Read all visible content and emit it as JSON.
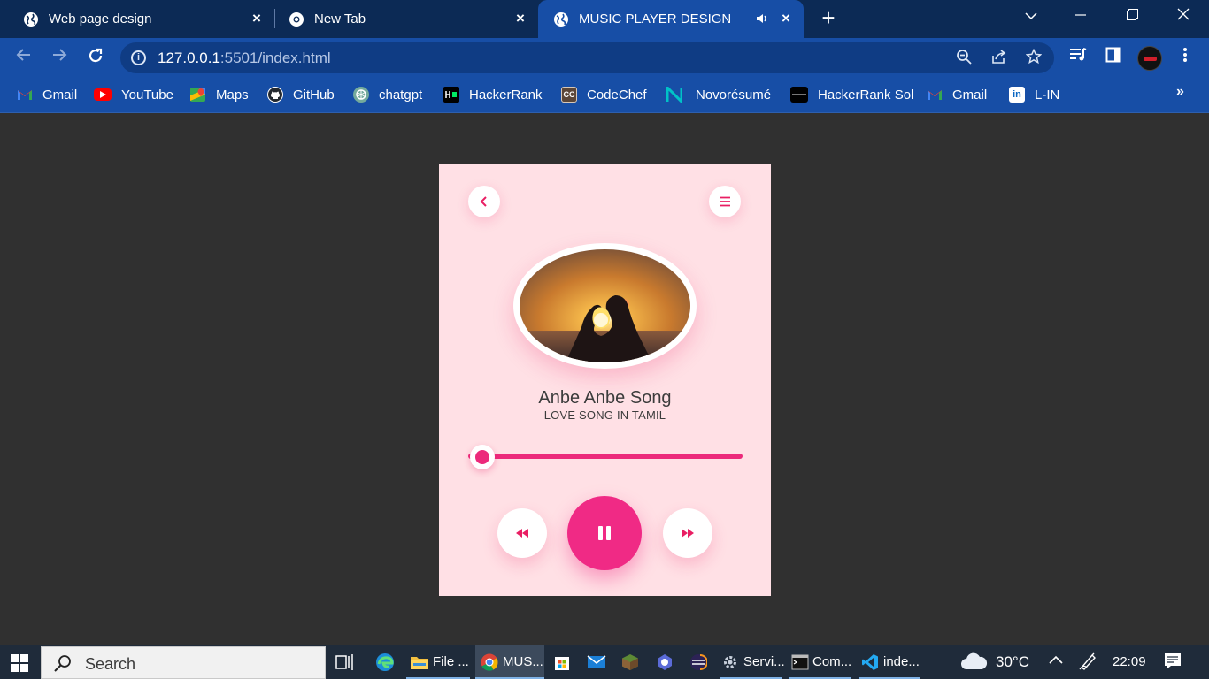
{
  "tabs": [
    {
      "title": "Web page design",
      "active": false,
      "icon": "globe-icon"
    },
    {
      "title": "New Tab",
      "active": false,
      "icon": "chrome-icon"
    },
    {
      "title": "MUSIC PLAYER DESIGN",
      "active": true,
      "icon": "globe-icon",
      "audio": true
    }
  ],
  "address": {
    "host": "127.0.0.1",
    "rest": ":5501/index.html"
  },
  "bookmarks": [
    {
      "label": "Gmail",
      "icon": "gmail-icon",
      "color": "#ea4335"
    },
    {
      "label": "YouTube",
      "icon": "youtube-icon",
      "color": "#ff0000"
    },
    {
      "label": "Maps",
      "icon": "maps-icon",
      "color": "#34a853"
    },
    {
      "label": "GitHub",
      "icon": "github-icon",
      "color": "#24292f"
    },
    {
      "label": "chatgpt",
      "icon": "chatgpt-icon",
      "color": "#74aa9c"
    },
    {
      "label": "HackerRank",
      "icon": "hackerrank-icon",
      "color": "#000000"
    },
    {
      "label": "CodeChef",
      "icon": "codechef-icon",
      "color": "#5b4638"
    },
    {
      "label": "Novorésumé",
      "icon": "novoresume-icon",
      "color": "#00c2c7"
    },
    {
      "label": "HackerRank Sol",
      "icon": "hackerrank-sol-icon",
      "color": "#000000"
    },
    {
      "label": "Gmail",
      "icon": "gmail-icon",
      "color": "#ea4335"
    },
    {
      "label": "L-IN",
      "icon": "linkedin-icon",
      "color": "#0a66c2"
    }
  ],
  "player": {
    "song_title": "Anbe Anbe Song",
    "artist": "LOVE SONG IN TAMIL",
    "progress": 0.05,
    "state": "playing",
    "accent": "#f02a85",
    "background": "#ffe0e5"
  },
  "taskbar": {
    "search_placeholder": "Search",
    "apps": [
      {
        "label": "",
        "icon": "task-view-icon"
      },
      {
        "label": "",
        "icon": "edge-icon"
      },
      {
        "label": "File ...",
        "icon": "file-explorer-icon"
      },
      {
        "label": "MUS...",
        "icon": "chrome-icon"
      },
      {
        "label": "",
        "icon": "store-icon"
      },
      {
        "label": "",
        "icon": "mail-icon"
      },
      {
        "label": "",
        "icon": "minecraft-icon"
      },
      {
        "label": "",
        "icon": "copilot-icon"
      },
      {
        "label": "",
        "icon": "eclipse-icon"
      },
      {
        "label": "Servi...",
        "icon": "services-icon"
      },
      {
        "label": "Com...",
        "icon": "command-prompt-icon"
      },
      {
        "label": "inde...",
        "icon": "vscode-icon"
      }
    ],
    "weather": "30°C",
    "time": "22:09"
  }
}
